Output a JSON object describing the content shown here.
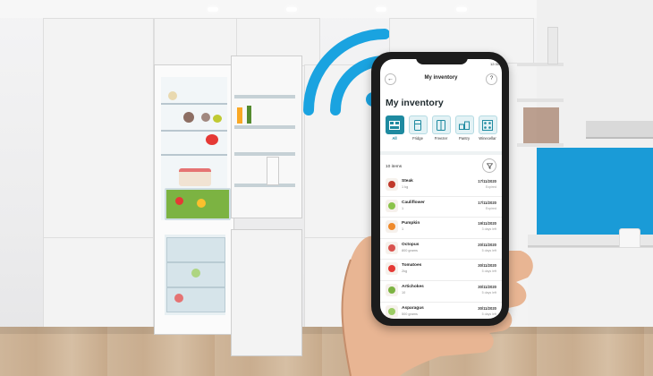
{
  "phone_app": {
    "status_time": "12:30",
    "nav_title": "My inventory",
    "back_icon": "arrow-left-icon",
    "help_icon": "question-icon",
    "page_title": "My inventory",
    "categories": [
      {
        "label": "All",
        "icon": "all-icon",
        "active": true
      },
      {
        "label": "Fridge",
        "icon": "fridge-icon",
        "active": false
      },
      {
        "label": "Freezer",
        "icon": "freezer-icon",
        "active": false
      },
      {
        "label": "Pantry",
        "icon": "pantry-icon",
        "active": false
      },
      {
        "label": "Winecellar",
        "icon": "winecellar-icon",
        "active": false
      }
    ],
    "item_count": "10 items",
    "filter_icon": "filter-icon",
    "items": [
      {
        "name": "Steak",
        "qty": "1 kg",
        "date": "17/11/2020",
        "status": "Expired",
        "color": "#c0392b"
      },
      {
        "name": "Cauliflower",
        "qty": "1",
        "date": "17/11/2020",
        "status": "Expired",
        "color": "#8bc34a"
      },
      {
        "name": "Pumpkin",
        "qty": "1",
        "date": "19/11/2020",
        "status": "3 days left",
        "color": "#ef8a2c"
      },
      {
        "name": "Octopus",
        "qty": "800 grams",
        "date": "20/11/2020",
        "status": "5 days left",
        "color": "#d9534f"
      },
      {
        "name": "Tomatoes",
        "qty": "2kg",
        "date": "30/11/2020",
        "status": "5 days left",
        "color": "#e53935"
      },
      {
        "name": "Artichokes",
        "qty": "10",
        "date": "30/11/2020",
        "status": "5 days left",
        "color": "#7cb342"
      },
      {
        "name": "Asparagus",
        "qty": "500 grams",
        "date": "30/11/2020",
        "status": "5 days left",
        "color": "#9ccc65"
      }
    ]
  },
  "colors": {
    "accent": "#1e8aa0",
    "wifi": "#1aa3e0",
    "backsplash": "#1a9bd7"
  }
}
